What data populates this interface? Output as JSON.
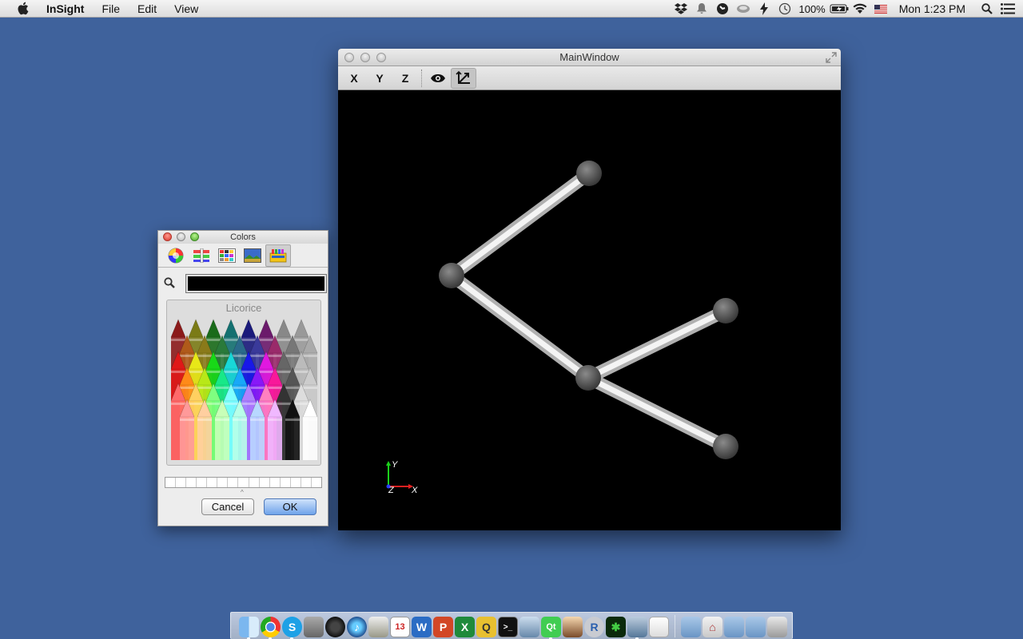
{
  "menubar": {
    "app_name": "InSight",
    "menus": [
      "File",
      "Edit",
      "View"
    ],
    "status": {
      "battery": "100%",
      "clock": "Mon 1:23 PM"
    }
  },
  "main_window": {
    "title": "MainWindow",
    "toolbar": {
      "x_label": "X",
      "y_label": "Y",
      "z_label": "Z"
    },
    "axes": {
      "y": "Y",
      "x": "X",
      "z": "Z"
    },
    "graph": {
      "nodes": [
        "node-a",
        "node-b",
        "node-c",
        "node-d",
        "node-e"
      ],
      "edges": [
        [
          "node-a",
          "node-b"
        ],
        [
          "node-b",
          "node-c"
        ],
        [
          "node-c",
          "node-d"
        ],
        [
          "node-c",
          "node-e"
        ]
      ],
      "background": "#000000"
    }
  },
  "colors_panel": {
    "title": "Colors",
    "selected_color_name": "Licorice",
    "selected_color": "#000000",
    "cancel_label": "Cancel",
    "ok_label": "OK"
  },
  "dock": {
    "icons": [
      "finder-icon",
      "chrome-icon",
      "skype-icon",
      "preview-icon",
      "itunes-icon",
      "itunes-music-icon",
      "script-editor-icon",
      "calendar-icon",
      "word-icon",
      "powerpoint-icon",
      "excel-icon",
      "qtcreator-icon",
      "terminal-icon",
      "xcode-icon",
      "qt-icon",
      "user-icon",
      "r-icon",
      "fern-icon",
      "tools-icon",
      "textedit-icon",
      "folder-applications-icon",
      "home-folder-icon",
      "documents-folder-icon",
      "downloads-folder-icon",
      "trash-icon"
    ]
  },
  "colors": {
    "desktop": "#3f629c",
    "accent_ok": "#6fa3ea"
  }
}
